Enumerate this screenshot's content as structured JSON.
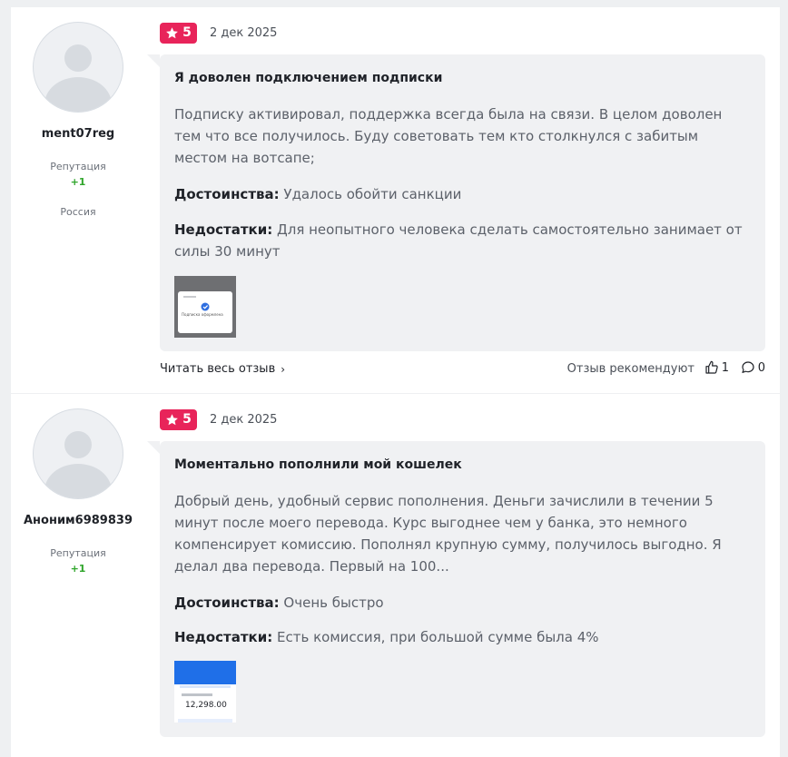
{
  "reviews": [
    {
      "username": "ment07reg",
      "reputation_label": "Репутация",
      "reputation_value": "+1",
      "country": "Россия",
      "rating": "5",
      "date": "2 дек 2025",
      "title": "Я доволен подключением подписки",
      "text": "Подписку активировал, поддержка всегда была на связи. В целом доволен тем что все получилось. Буду советовать тем кто столкнулся с забитым местом на вотсапе;",
      "pros_label": "Достоинства:",
      "pros": "Удалось обойти санкции",
      "cons_label": "Недостатки:",
      "cons": "Для неопытного человека сделать самостоятельно занимает от силы 30 минут",
      "thumbnail_caption": "Подписка оформлена",
      "read_more": "Читать весь отзыв",
      "recommend_label": "Отзыв рекомендуют",
      "likes": "1",
      "comments": "0"
    },
    {
      "username": "Аноним6989839",
      "reputation_label": "Репутация",
      "reputation_value": "+1",
      "rating": "5",
      "date": "2 дек 2025",
      "title": "Моментально пополнили мой кошелек",
      "text": "Добрый день, удобный сервис пополнения. Деньги зачислили в течении 5 минут после моего перевода. Курс выгоднее чем у банка, это немного компенсирует комиссию. Пополнял крупную сумму, получилось выгодно. Я делал два перевода. Первый на 100...",
      "pros_label": "Достоинства:",
      "pros": "Очень быстро",
      "cons_label": "Недостатки:",
      "cons": "Есть комиссия, при большой сумме была 4%",
      "thumbnail_amount": "12,298.00"
    }
  ],
  "colors": {
    "rating_badge": "#e8245a",
    "reputation": "#2fa52b",
    "bubble": "#f0f1f3"
  }
}
